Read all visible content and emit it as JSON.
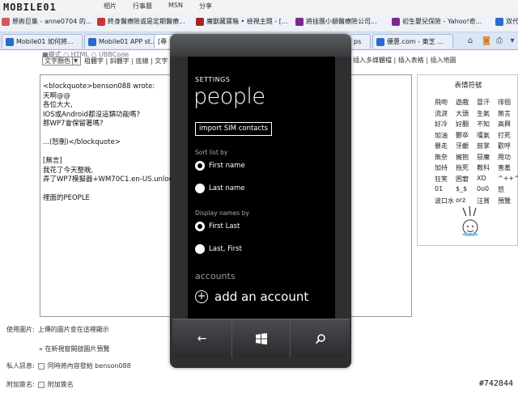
{
  "browser": {
    "logo": "MOBILE01",
    "menu": [
      "相片",
      "行事曆",
      "MSN",
      "分享"
    ],
    "bookmarks": [
      {
        "label": "懸術巨集 - anne0704 的...",
        "color": "#d55"
      },
      {
        "label": "終身醫療險或是定期醫療...",
        "color": "#c33"
      },
      {
        "label": "魔獸藏寶箱 • 檢視主題 - [...",
        "color": "#a22"
      },
      {
        "label": "將挂團小額醫療險公司...",
        "color": "#7a2a8a"
      },
      {
        "label": "初生嬰兒保險 - Yahoo!奇...",
        "color": "#7a2a8a"
      },
      {
        "label": "双代",
        "color": "#2a6ac8"
      }
    ],
    "tabs": [
      {
        "label": "Mobile01 如何將...",
        "active": false
      },
      {
        "label": "Mobile01 APP st...",
        "active": false
      },
      {
        "label": "[尋",
        "active": true
      },
      {
        "label": "ps",
        "active": false
      },
      {
        "label": "優惠.com - 東芝 ...",
        "active": false
      }
    ]
  },
  "editor": {
    "format_row": "■模式  ○ HTML  ○ UBBCode",
    "color_select": "文字顏色",
    "format_buttons": "粗體字 | 斜體字 | 底線 | 文字",
    "format_buttons_right": "插入多媒體檔 | 插入表格 | 插入地圖",
    "content": "<blockquote>benson088 wrote:\n天啊@@\n各位大大,\nIOS或Android都沒這類功能嗎?\n那WP7會保留著嗎?\n\n...(恕刪)</blockquote>\n\n[無言]\n我花了今天整晚,\n弄了WP7模擬器+WM70C1.en-US.unlock\n\n裡面的PEOPLE"
  },
  "emoji_panel": {
    "title": "表情符號",
    "items": [
      "飛吻",
      "遊戲",
      "冒汗",
      "徘徊",
      "流淚",
      "大頭",
      "生氣",
      "無言",
      "好冷",
      "好翻",
      "不知",
      "高興",
      "加油",
      "鬱卒",
      "嘆氣",
      "打死",
      "暴走",
      "牙齦",
      "鼓掌",
      "歡呼",
      "無奈",
      "擁抱",
      "惡魔",
      "用功",
      "加持",
      "拖死",
      "教科",
      "害羞",
      "狂笑",
      "困窘",
      "XD",
      "^++^",
      "01",
      "$_$",
      "0o0",
      "怒",
      "波口水",
      "orz",
      "汪賞",
      "預覽"
    ]
  },
  "below": {
    "upload_label": "使用圖片:",
    "upload_text": "上傳的圖片會在這裡顯示",
    "preview_link": "» 在新視窗開啟圖片預覽",
    "notify_label": "私人訊息:",
    "notify_text": "同時將內容發給 benson088",
    "signature_label": "附加簽名:",
    "signature_text": "附加簽名"
  },
  "watermark": "#742844",
  "phone": {
    "header": "SETTINGS",
    "title": "people",
    "import_button": "import SIM contacts",
    "sort_label": "Sort list by",
    "sort_options": [
      {
        "label": "First name",
        "selected": true
      },
      {
        "label": "Last name",
        "selected": false
      }
    ],
    "display_label": "Display names by",
    "display_options": [
      {
        "label": "First Last",
        "selected": true
      },
      {
        "label": "Last, First",
        "selected": false
      }
    ],
    "accounts_heading": "accounts",
    "add_account": "add an account",
    "buttons": [
      "back-icon",
      "windows-icon",
      "search-icon"
    ]
  }
}
